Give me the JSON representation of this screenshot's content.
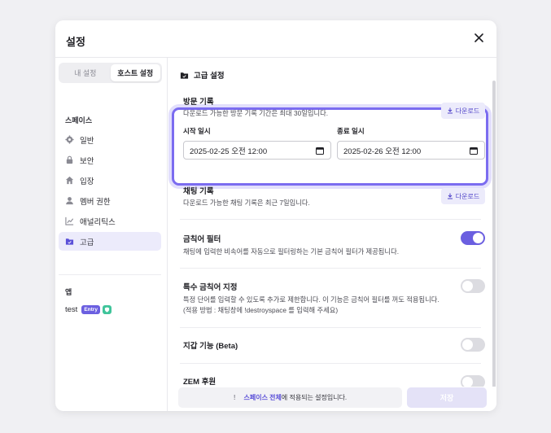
{
  "modal": {
    "title": "설정"
  },
  "sidebar": {
    "tabs": [
      {
        "label": "내 설정",
        "active": false
      },
      {
        "label": "호스트 설정",
        "active": true
      }
    ],
    "space_label": "스페이스",
    "items": [
      {
        "label": "일반",
        "icon": "gear-icon"
      },
      {
        "label": "보안",
        "icon": "lock-icon"
      },
      {
        "label": "입장",
        "icon": "home-icon"
      },
      {
        "label": "멤버 권한",
        "icon": "user-icon"
      },
      {
        "label": "애널리틱스",
        "icon": "chart-icon"
      },
      {
        "label": "고급",
        "icon": "folder-icon",
        "active": true
      }
    ],
    "app_label": "앱",
    "app": {
      "name": "test",
      "badge": "Entry"
    }
  },
  "content": {
    "title": "고급 설정",
    "visit_log": {
      "title": "방문 기록",
      "desc": "다운로드 가능한 방문 기록 기간은 최대 30일입니다.",
      "download_label": "다운로드",
      "start_label": "시작 일시",
      "start_value": "2025-02-25 오전 12:00",
      "end_label": "종료 일시",
      "end_value": "2025-02-26 오전 12:00"
    },
    "chat_log": {
      "title": "채팅 기록",
      "desc": "다운로드 가능한 채팅 기록은 최근 7일입니다.",
      "download_label": "다운로드"
    },
    "profanity": {
      "title": "금칙어 필터",
      "desc": "채팅에 입력한 비속어를 자동으로 필터링하는 기본 금칙어 필터가 제공됩니다.",
      "on": true
    },
    "custom_profanity": {
      "title": "특수 금칙어 지정",
      "desc1": "특정 단어를 입력할 수 있도록 추가로 제한합니다. 이 기능은 금칙어 필터를 꺼도 적용됩니다.",
      "desc2": "(적용 방법 : 채팅창에 !destroyspace 를 입력해 주세요)",
      "on": false
    },
    "earthquake": {
      "title": "지갑 기능 (Beta)",
      "on": false
    },
    "zem": {
      "title": "ZEM 후원",
      "on": false
    }
  },
  "footer": {
    "notice_icon": "!",
    "notice_highlight": "스페이스 전체",
    "notice_rest": "에 적용되는 설정입니다.",
    "save_label": "저장"
  },
  "colors": {
    "accent": "#6b5fe0",
    "accent_light": "#ecebfb"
  }
}
